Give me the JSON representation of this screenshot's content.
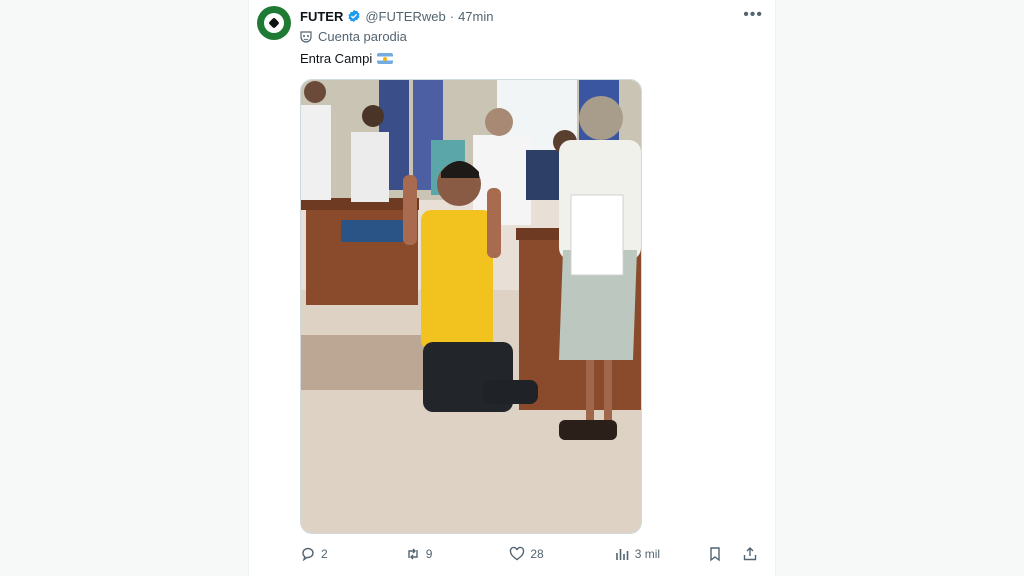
{
  "tweet": {
    "display_name": "FUTER",
    "handle": "@FUTERweb",
    "separator": "·",
    "time": "47min",
    "parody_label": "Cuenta parodia",
    "text": "Entra Campi",
    "text_emoji": "argentina-flag",
    "more_icon": "more-icon",
    "media_description": "photo"
  },
  "actions": {
    "replies": "2",
    "reposts": "9",
    "likes": "28",
    "views": "3 mil"
  },
  "colors": {
    "verified": "#1d9bf0",
    "muted_text": "#536471",
    "avatar_bg": "#1f7a34"
  }
}
